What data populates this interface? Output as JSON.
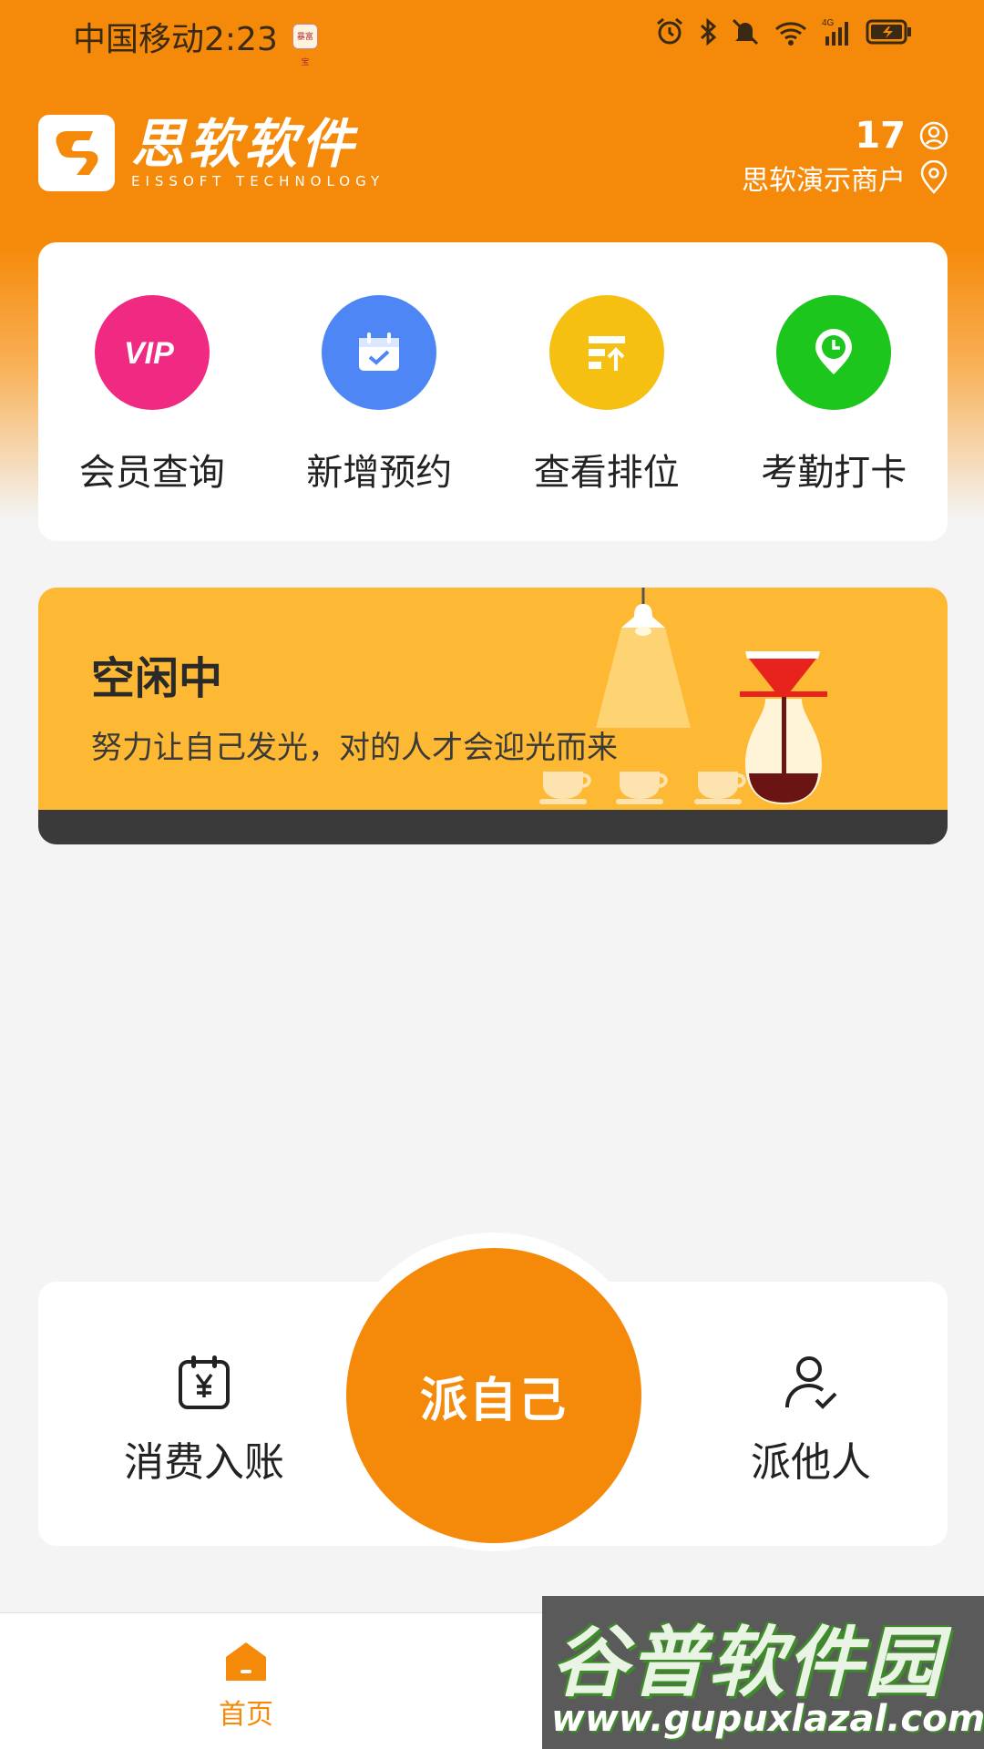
{
  "status_bar": {
    "carrier_time": "中国移动2:23",
    "mini_icon_text": "暴富宝"
  },
  "brand": {
    "name": "思软软件",
    "subtitle": "EISSOFT TECHNOLOGY",
    "logo_icon": "s-logo-icon"
  },
  "user": {
    "id": "17",
    "merchant": "思软演示商户",
    "user_icon": "user-circle-icon",
    "location_icon": "location-pin-icon"
  },
  "quick_actions": [
    {
      "label": "会员查询",
      "icon": "vip-icon",
      "color": "#f02a82"
    },
    {
      "label": "新增预约",
      "icon": "calendar-check-icon",
      "color": "#4e86f5"
    },
    {
      "label": "查看排位",
      "icon": "queue-ranking-icon",
      "color": "#f6c012"
    },
    {
      "label": "考勤打卡",
      "icon": "clock-pin-icon",
      "color": "#1dc61d"
    }
  ],
  "banner": {
    "title": "空闲中",
    "subtitle": "努力让自己发光，对的人才会迎光而来",
    "background": "#fdb933"
  },
  "dispatch": {
    "left_label": "消费入账",
    "left_icon": "calendar-yen-icon",
    "main_label": "派自己",
    "right_label": "派他人",
    "right_icon": "user-check-icon",
    "accent": "#f58a0a"
  },
  "bottom_nav": {
    "home_label": "首页",
    "home_icon": "home-icon"
  },
  "watermark": {
    "title": "谷普软件园",
    "url": "www.gupuxlazal.com"
  }
}
